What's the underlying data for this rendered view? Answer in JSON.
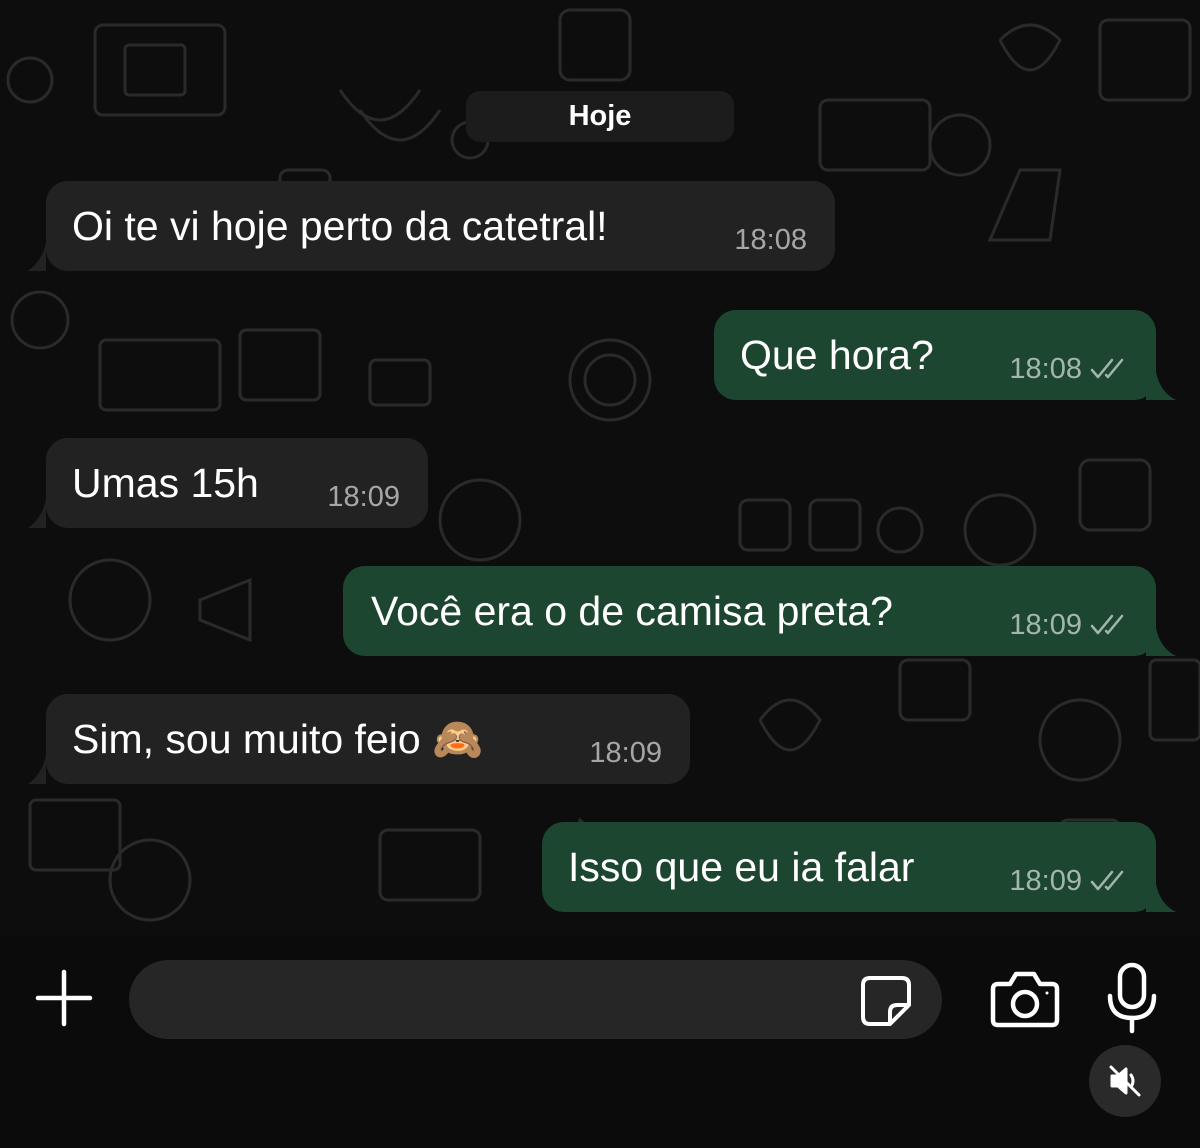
{
  "chat": {
    "date_label": "Hoje",
    "messages": [
      {
        "direction": "in",
        "text": "Oi te vi hoje perto da catetral!",
        "time": "18:08"
      },
      {
        "direction": "out",
        "text": "Que hora?",
        "time": "18:08",
        "status": "read-ticks-icon"
      },
      {
        "direction": "in",
        "text": "Umas 15h",
        "time": "18:09"
      },
      {
        "direction": "out",
        "text": "Você era o de camisa preta?",
        "time": "18:09",
        "status": "read-ticks-icon"
      },
      {
        "direction": "in",
        "text": "Sim, sou muito feio 🙈",
        "time": "18:09"
      },
      {
        "direction": "out",
        "text": "Isso que eu ia falar",
        "time": "18:09",
        "status": "read-ticks-icon"
      }
    ]
  },
  "composer": {
    "input_value": "",
    "icons": [
      "plus-icon",
      "sticker-icon",
      "camera-icon",
      "microphone-icon",
      "speaker-muted-icon"
    ]
  },
  "colors": {
    "incoming_bubble": "#222222",
    "outgoing_bubble": "#1d4631",
    "background": "#0d0d0d",
    "input": "#262626"
  }
}
